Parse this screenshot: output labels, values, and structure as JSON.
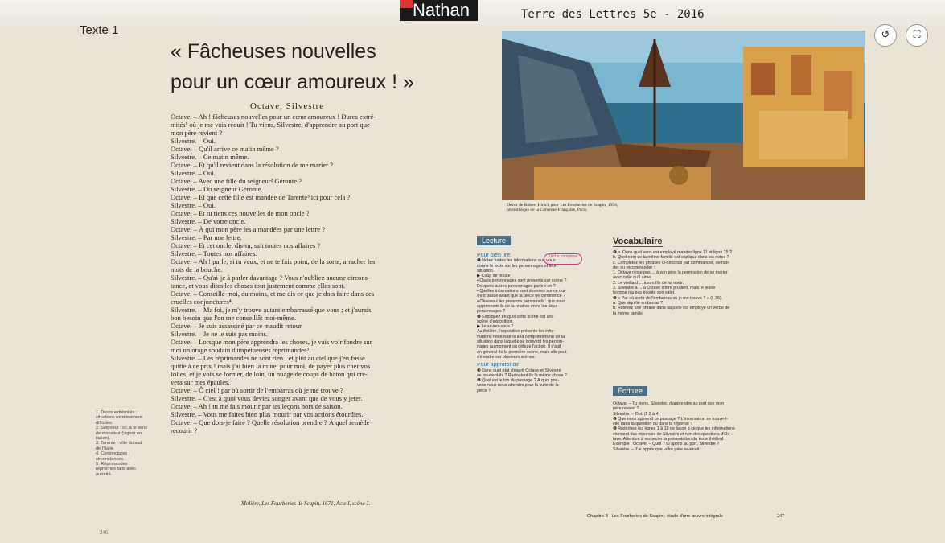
{
  "header": {
    "brand": "Nathan",
    "book_title": "Terre des Lettres 5e - 2016"
  },
  "controls": {
    "rotate_glyph": "↺",
    "fullscreen_glyph": "⛶"
  },
  "left_page": {
    "tab_label": "Texte 1",
    "title_line1": "« Fâcheuses nouvelles",
    "title_line2": "pour un cœur amoureux ! »",
    "speakers": "Octave, Silvestre",
    "play_lines": [
      "Octave. – Ah ! fâcheuses nouvelles pour un cœur amoureux ! Dures extré-",
      "mités¹ où je me vois réduit ! Tu viens, Silvestre, d'apprendre au port que",
      "mon père revient ?",
      "Silvestre. – Oui.",
      "Octave. – Qu'il arrive ce matin même ?",
      "Silvestre. – Ce matin même.",
      "Octave. – Et qu'il revient dans la résolution de me marier ?",
      "Silvestre. – Oui.",
      "Octave. – Avec une fille du seigneur² Géronte ?",
      "Silvestre. – Du seigneur Géronte.",
      "Octave. – Et que cette fille est mandée de Tarente³ ici pour cela ?",
      "Silvestre. – Oui.",
      "Octave. – Et tu tiens ces nouvelles de mon oncle ?",
      "Silvestre. – De votre oncle.",
      "Octave. – À qui mon père les a mandées par une lettre ?",
      "Silvestre. – Par une lettre.",
      "Octave. – Et cet oncle, dis-tu, sait toutes nos affaires ?",
      "Silvestre. – Toutes nos affaires.",
      "Octave. – Ah ! parle, si tu veux, et ne te fais point, de la sorte, arracher les",
      "mots de la bouche.",
      "Silvestre. – Qu'ai-je à parler davantage ? Vous n'oubliez aucune circons-",
      "tance, et vous dites les choses tout justement comme elles sont.",
      "Octave. – Conseille-moi, du moins, et me dis ce que je dois faire dans ces",
      "cruelles conjonctures⁴.",
      "Silvestre. – Ma foi, je m'y trouve autant embarrassé que vous ; et j'aurais",
      "bon besoin que l'on me conseillât moi-même.",
      "Octave. – Je suis assassiné par ce maudit retour.",
      "Silvestre. – Je ne le suis pas moins.",
      "Octave. – Lorsque mon père apprendra les choses, je vais voir fondre sur",
      "moi un orage soudain d'impétueuses réprimandes⁵.",
      "Silvestre. – Les réprimandes ne sont rien ; et plût au ciel que j'en fusse",
      "quitte à ce prix ! mais j'ai bien la mine, pour moi, de payer plus cher vos",
      "folies, et je vois se former, de loin, un nuage de coups de bâton qui cre-",
      "vera sur mes épaules.",
      "Octave. – Ô ciel ! par où sortir de l'embarras où je me trouve ?",
      "Silvestre. – C'est à quoi vous deviez songer avant que de vous y jeter.",
      "Octave. – Ah ! tu me fais mourir par tes leçons hors de saison.",
      "Silvestre. – Vous me faites bien plus mourir par vos actions étourdies.",
      "Octave. – Que dois-je faire ? Quelle résolution prendre ? À quel remède",
      "recourir ?"
    ],
    "glossary": [
      "1. Dures extrémités :",
      "situations extrêmement",
      "difficiles.",
      "2. Seigneur : ici, à le sens",
      "de monsieur (signor en",
      "italien).",
      "3. Tarente : ville du sud",
      "de l'Italie.",
      "4. Conjonctures :",
      "circonstances.",
      "5. Réprimandes :",
      "reproches faits avec",
      "autorité."
    ],
    "source": "Molière, Les Fourberies de Scapin, 1671, Acte I, scène 1.",
    "page_number": "246"
  },
  "right_page": {
    "caption_line1": "Décor de Robert Hirsch pour Les Fourberies de Scapin, 1956,",
    "caption_line2": "bibliothèque de la Comédie-Française, Paris.",
    "lecture": {
      "heading": "Lecture",
      "tache": "Tâche complexe",
      "sub1": "Pour bien lire",
      "lines": [
        "❶ Notez toutes les informations que vous",
        "donne le texte sur les personnages et leur",
        "situation.",
        "▶ Coup de pouce",
        "• Quels personnages sont présents sur scène ?",
        "De quels autres personnages parle-t-on ?",
        "• Quelles informations sont données sur ce qui",
        "s'est passé avant que la pièce ne commence ?",
        "• Observez les pronoms personnels : que nous",
        "apprennent-ils de la relation entre les deux",
        "personnages ?",
        "❷ Expliquez en quoi cette scène est une",
        "scène d'exposition.",
        "▶ Le saviez-vous ?",
        "Au théâtre, l'exposition présente les infor-",
        "mations nécessaires à la compréhension de la",
        "situation dans laquelle se trouvent les person-",
        "nages au moment où débute l'action. Il s'agit",
        "en général de la première scène, mais elle peut",
        "s'étendre sur plusieurs scènes."
      ],
      "sub2": "Pour approfondir",
      "lines2": [
        "❸ Dans quel état d'esprit Octave et Silvestre",
        "se trouvent-ils ? Redoutent-ils la même chose ?",
        "❹ Quel est le ton du passage ? À quoi pou-",
        "vons-nous nous attendre pour la suite de la",
        "pièce ?"
      ]
    },
    "vocab": {
      "heading": "Vocabulaire",
      "lines": [
        "❶ a. Dans quel sens est employé mander ligne 11 et ligne 15 ?",
        "b. Quel nom de la même famille est expliqué dans les notes ?",
        "c. Complétez les phrases ci-dessous par commander, deman-",
        "der ou recommander :",
        "1. Octave n'ose pas ... à son père la permission de se marier",
        "avec celle qu'il aime.",
        "2. Le vieillard ... à son fils de lui obéir.",
        "3. Silvestre a ... à Octave d'être prudent, mais le jeune",
        "homme n'a pas écouté son valet.",
        "❷ « Par où sortir de l'embarras où je me trouve ? » (l. 35).",
        "a. Que signifie embarras ?",
        "b. Relevez une phrase dans laquelle est employé un verbe de",
        "la même famille."
      ]
    },
    "ecriture": {
      "heading": "Écriture",
      "lines": [
        "Octave. – Tu viens, Silvestre, d'apprendre au port que mon",
        "père revient ?",
        "Silvestre. – Oui. (l. 2 à 4)",
        "❶ Que nous apprend ce passage ? L'information se trouve-t-",
        "elle dans la question ou dans la réponse ?",
        "❷ Réécrivez les lignes 1 à 18 de façon à ce que les informations",
        "viennent des réponses de Silvestre et non des questions d'Oc-",
        "tave. Attention à respecter la présentation du texte théâtral.",
        "Exemple : Octave. – Quoi ? tu appris au port, Silvestre ?",
        "Silvestre. – J'ai appris que votre père revenait."
      ]
    },
    "footer": "Chapitre 8 · Les Fourberies de Scapin : étude d'une œuvre intégrale",
    "page_number": "247"
  }
}
